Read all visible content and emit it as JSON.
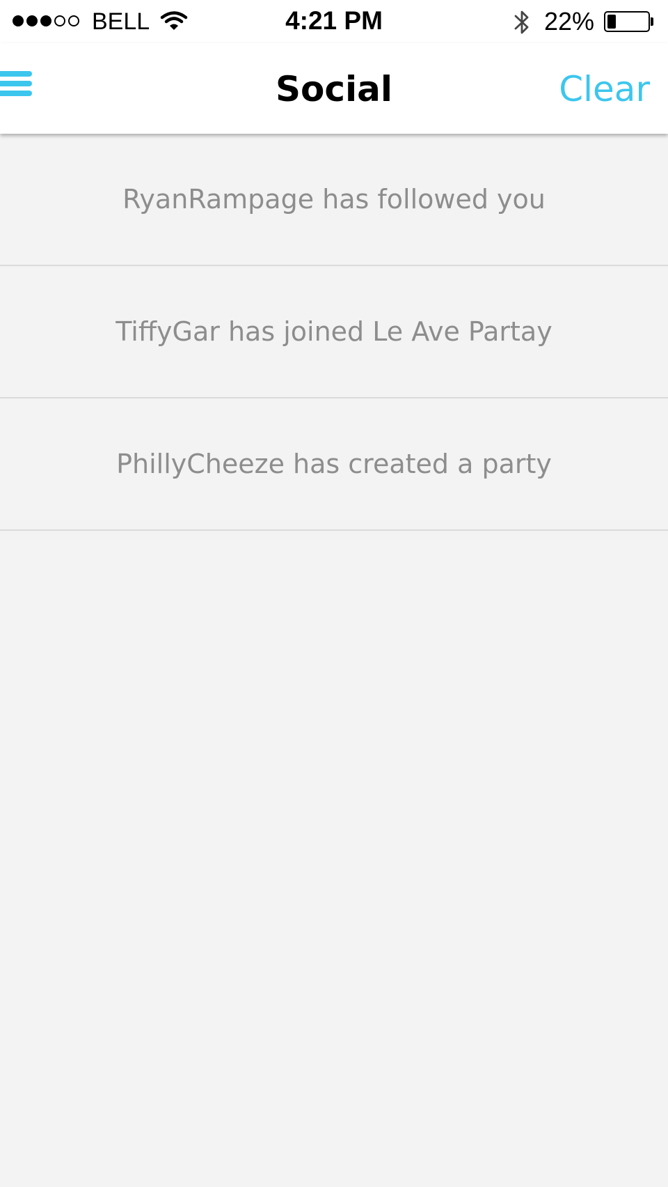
{
  "status_bar": {
    "signal_bars_filled": 3,
    "signal_bars_total": 5,
    "carrier": "BELL",
    "wifi_icon": "wifi-icon",
    "time": "4:21 PM",
    "bluetooth_icon": "bluetooth-icon",
    "battery_percent": "22%",
    "battery_level": 0.22
  },
  "nav": {
    "menu_icon": "hamburger-menu-icon",
    "title": "Social",
    "clear_label": "Clear"
  },
  "notifications": [
    {
      "text": "RyanRampage has followed you"
    },
    {
      "text": "TiffyGar has joined Le Ave Partay"
    },
    {
      "text": "PhillyCheeze has created a party"
    }
  ],
  "colors": {
    "accent": "#3cc6ee",
    "notification_text": "#8d8d8d",
    "background": "#f3f3f3",
    "divider": "#dadada"
  }
}
